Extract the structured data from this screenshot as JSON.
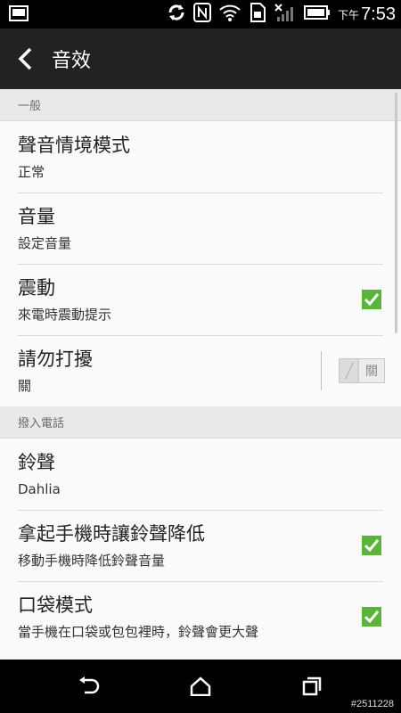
{
  "status_bar": {
    "time_prefix": "下午",
    "time": "7:53",
    "icons": [
      "screenshot-icon",
      "sync-icon",
      "nfc-icon",
      "wifi-icon",
      "sd-card-icon",
      "no-signal-icon",
      "battery-icon"
    ]
  },
  "action_bar": {
    "title": "音效"
  },
  "sections": {
    "general": {
      "header": "一般",
      "sound_profile": {
        "title": "聲音情境模式",
        "subtitle": "正常"
      },
      "volume": {
        "title": "音量",
        "subtitle": "設定音量"
      },
      "vibrate": {
        "title": "震動",
        "subtitle": "來電時震動提示",
        "checked": true
      },
      "do_not_disturb": {
        "title": "請勿打擾",
        "subtitle": "關",
        "toggle_label": "關"
      }
    },
    "incoming_calls": {
      "header": "撥入電話",
      "ringtone": {
        "title": "鈴聲",
        "subtitle": "Dahlia"
      },
      "quiet_ring": {
        "title": "拿起手機時讓鈴聲降低",
        "subtitle": "移動手機時降低鈴聲音量",
        "checked": true
      },
      "pocket_mode": {
        "title": "口袋模式",
        "subtitle": "當手機在口袋或包包裡時，鈴聲會更大聲",
        "checked": true
      }
    }
  },
  "nav_bar": {
    "watermark": "#2511228"
  },
  "colors": {
    "accent": "#5ab43c",
    "action_bar_bg": "#222222",
    "section_bg": "#e9e9e9"
  }
}
